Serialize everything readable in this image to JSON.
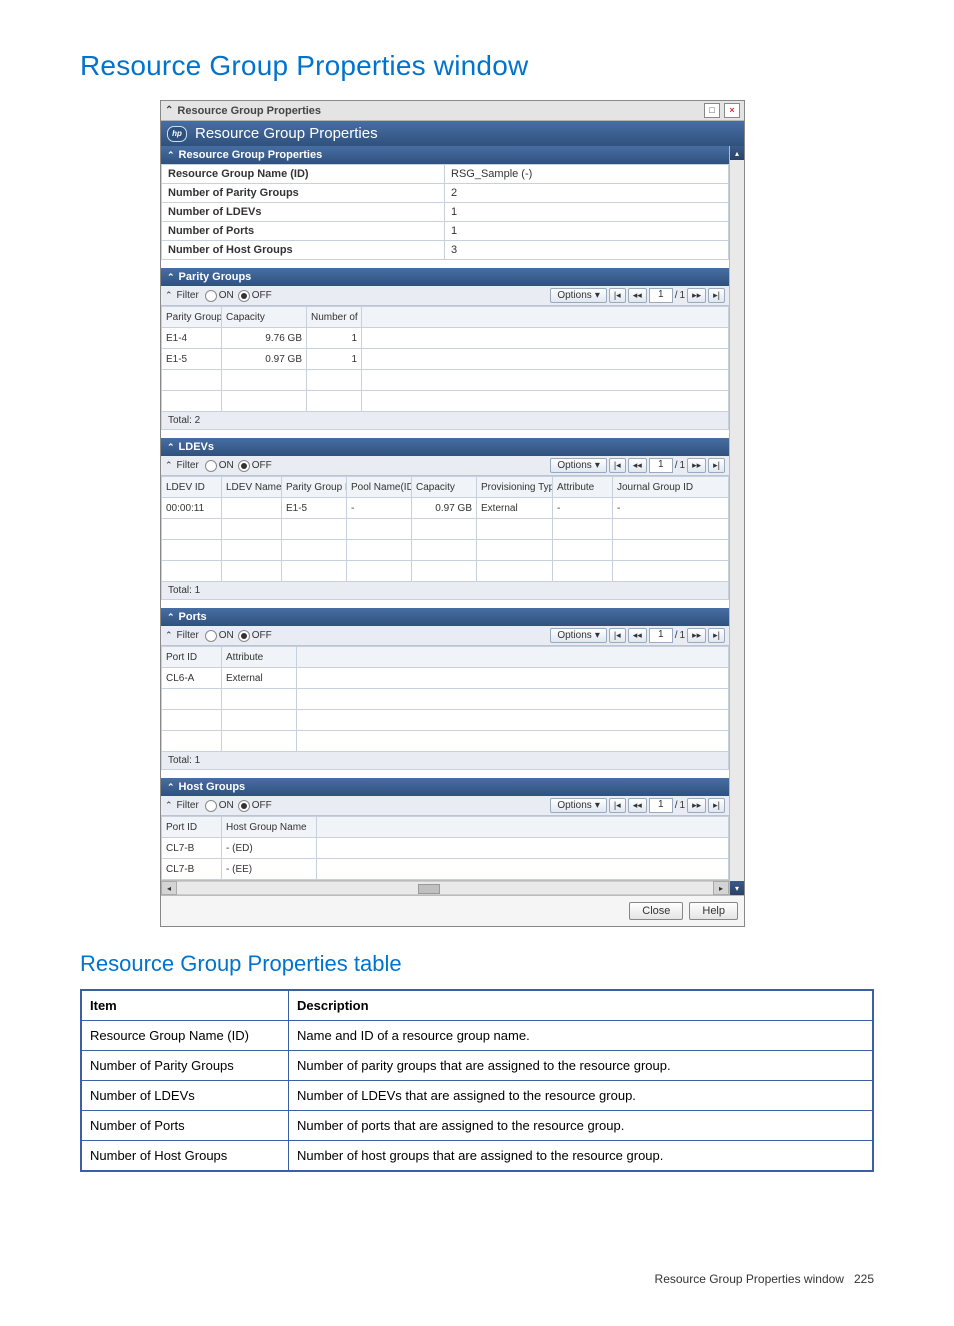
{
  "doc": {
    "title": "Resource Group Properties window",
    "subtitle": "Resource Group Properties table",
    "footer_text": "Resource Group Properties window",
    "page_number": "225"
  },
  "app": {
    "titlebar": "Resource Group Properties",
    "header": "Resource Group Properties",
    "close_btn": "Close",
    "help_btn": "Help",
    "filter_label": "Filter",
    "filter_on": "ON",
    "filter_off": "OFF",
    "options_label": "Options",
    "pager": {
      "current": "1",
      "sep": "/",
      "total": "1"
    },
    "props_section": "Resource Group Properties",
    "props": {
      "name_id_k": "Resource Group Name (ID)",
      "name_id_v": "RSG_Sample (-)",
      "parity_k": "Number of Parity Groups",
      "parity_v": "2",
      "ldev_k": "Number of LDEVs",
      "ldev_v": "1",
      "ports_k": "Number of Ports",
      "ports_v": "1",
      "hg_k": "Number of Host Groups",
      "hg_v": "3"
    },
    "parity": {
      "title": "Parity Groups",
      "cols": {
        "c1": "Parity Group ID",
        "c2": "Capacity",
        "c3": "Number of LDEVs"
      },
      "r1": {
        "id": "E1-4",
        "cap": "9.76 GB",
        "n": "1"
      },
      "r2": {
        "id": "E1-5",
        "cap": "0.97 GB",
        "n": "1"
      },
      "total": "Total: 2"
    },
    "ldevs": {
      "title": "LDEVs",
      "cols": {
        "c1": "LDEV ID",
        "c2": "LDEV Name",
        "c3": "Parity Group ID",
        "c4": "Pool Name(ID)",
        "c5": "Capacity",
        "c6": "Provisioning Type",
        "c7": "Attribute",
        "c8": "Journal Group ID"
      },
      "r1": {
        "id": "00:00:11",
        "name": "",
        "pg": "E1-5",
        "pool": "-",
        "cap": "0.97 GB",
        "prov": "External",
        "attr": "-",
        "jg": "-"
      },
      "total": "Total: 1"
    },
    "ports": {
      "title": "Ports",
      "cols": {
        "c1": "Port ID",
        "c2": "Attribute"
      },
      "r1": {
        "id": "CL6-A",
        "attr": "External"
      },
      "total": "Total: 1"
    },
    "hg": {
      "title": "Host Groups",
      "cols": {
        "c1": "Port ID",
        "c2": "Host Group Name"
      },
      "r1": {
        "id": "CL7-B",
        "name": "- (ED)"
      },
      "r2": {
        "id": "CL7-B",
        "name": "- (EE)"
      }
    }
  },
  "table": {
    "h1": "Item",
    "h2": "Description",
    "r1k": "Resource Group Name (ID)",
    "r1v": "Name and ID of a resource group name.",
    "r2k": "Number of Parity Groups",
    "r2v": "Number of parity groups that are assigned to the resource group.",
    "r3k": "Number of LDEVs",
    "r3v": "Number of LDEVs that are assigned to the resource group.",
    "r4k": "Number of Ports",
    "r4v": "Number of ports that are assigned to the resource group.",
    "r5k": "Number of Host Groups",
    "r5v": "Number of host groups that are assigned to the resource group."
  }
}
